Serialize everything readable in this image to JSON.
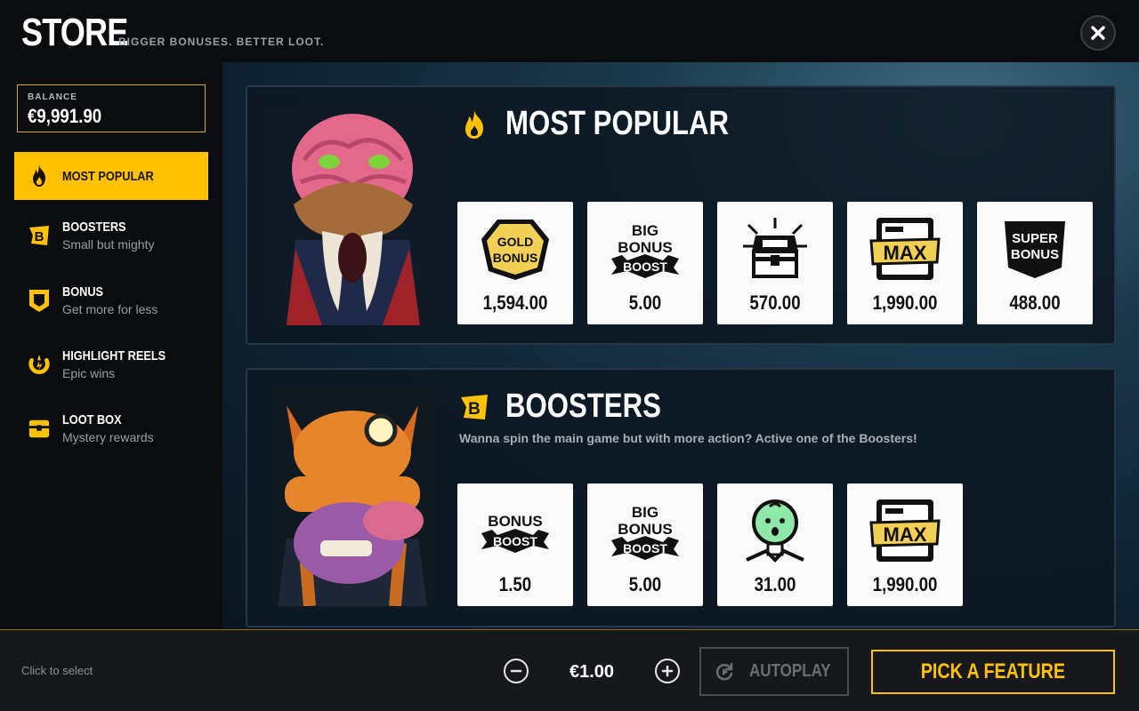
{
  "header": {
    "title": "STORE",
    "subtitle": "BIGGER BONUSES. BETTER LOOT."
  },
  "balance": {
    "label": "BALANCE",
    "value": "€9,991.90"
  },
  "sidebar": {
    "items": [
      {
        "title": "MOST POPULAR",
        "subtitle": "",
        "icon": "flame-icon",
        "active": true
      },
      {
        "title": "BOOSTERS",
        "subtitle": "Small but mighty",
        "icon": "booster-b-icon",
        "active": false
      },
      {
        "title": "BONUS",
        "subtitle": "Get more for less",
        "icon": "bonus-shield-icon",
        "active": false
      },
      {
        "title": "HIGHLIGHT REELS",
        "subtitle": "Epic wins",
        "icon": "highlight-reel-icon",
        "active": false
      },
      {
        "title": "LOOT BOX",
        "subtitle": "Mystery rewards",
        "icon": "loot-box-icon",
        "active": false
      }
    ]
  },
  "sections": [
    {
      "title": "MOST POPULAR",
      "description": "",
      "icon": "flame-icon",
      "cards": [
        {
          "art": "gold-bonus",
          "price": "1,594.00"
        },
        {
          "art": "big-bonus-boost",
          "price": "5.00"
        },
        {
          "art": "treasure-chest",
          "price": "570.00"
        },
        {
          "art": "max",
          "price": "1,990.00"
        },
        {
          "art": "super-bonus",
          "price": "488.00"
        }
      ]
    },
    {
      "title": "BOOSTERS",
      "description": "Wanna spin the main game but with more action? Active one of the Boosters!",
      "icon": "booster-b-icon",
      "cards": [
        {
          "art": "bonus-boost",
          "price": "1.50"
        },
        {
          "art": "big-bonus-boost",
          "price": "5.00"
        },
        {
          "art": "green-baby",
          "price": "31.00"
        },
        {
          "art": "max",
          "price": "1,990.00"
        }
      ]
    }
  ],
  "bottom_bar": {
    "hint": "Click to select",
    "bet": "€1.00",
    "autoplay_label": "AUTOPLAY",
    "pick_label": "PICK A FEATURE"
  },
  "colors": {
    "accent": "#ffc200",
    "background": "#0b0c0e",
    "card": "#fafafa"
  }
}
